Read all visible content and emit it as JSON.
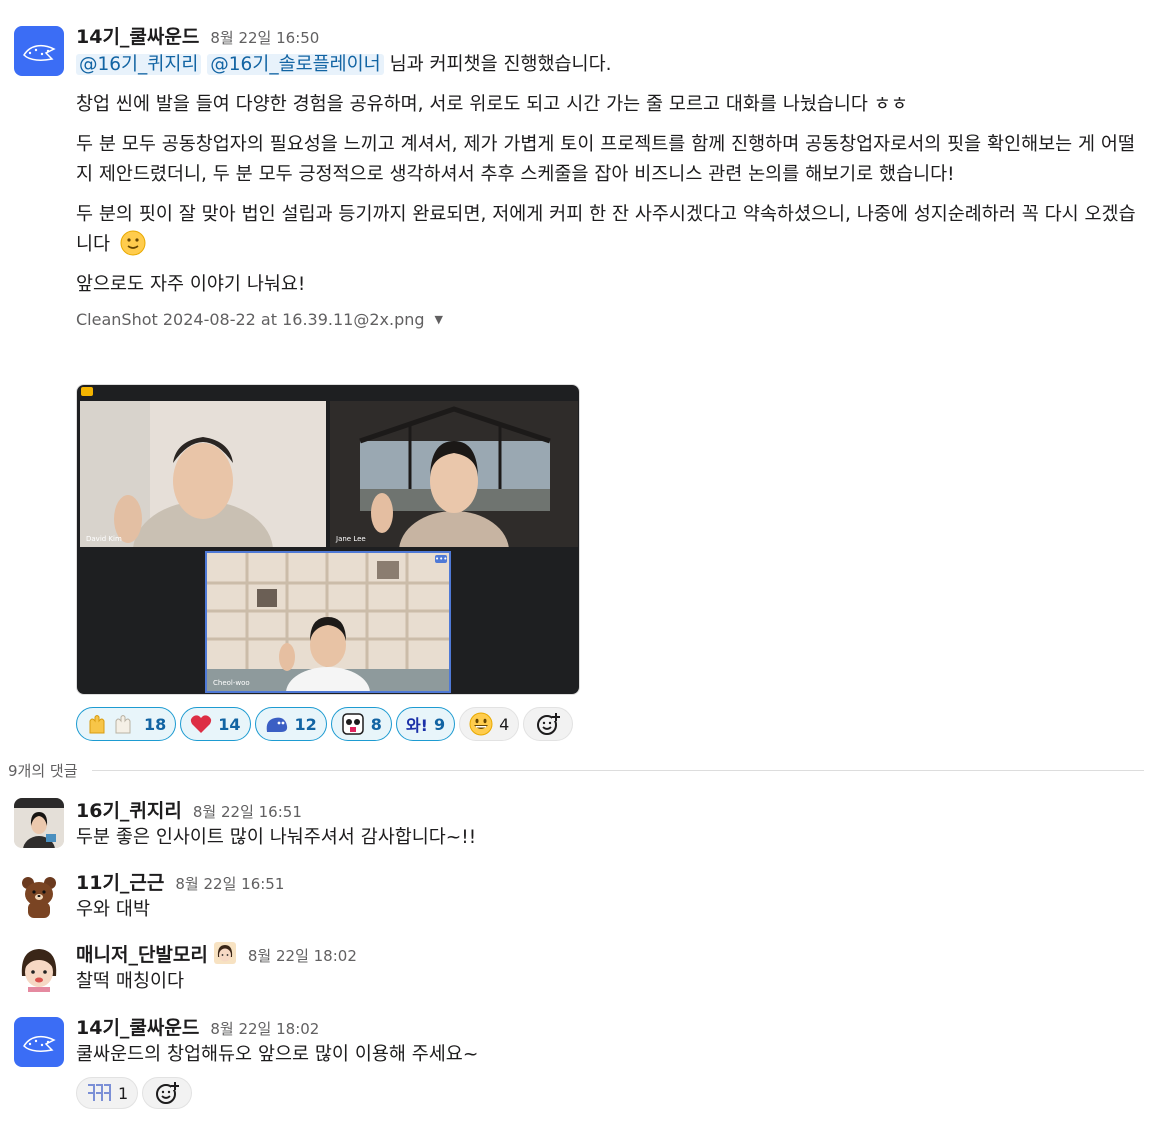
{
  "main_post": {
    "author": "14기_쿨싸운드",
    "time": "8월 22일 16:50",
    "mentions": [
      "@16기_퀴지리",
      "@16기_솔로플레이너"
    ],
    "first_line_suffix": "님과 커피챗을 진행했습니다.",
    "paragraphs": [
      "창업 씬에 발을 들여 다양한 경험을 공유하며, 서로 위로도 되고 시간 가는 줄 모르고 대화를 나눴습니다 ㅎㅎ",
      "두 분 모두 공동창업자의 필요성을 느끼고 계셔서, 제가 가볍게 토이 프로젝트를 함께 진행하며 공동창업자로서의 핏을 확인해보는 게 어떨지 제안드렸더니, 두 분 모두 긍정적으로 생각하셔서 추후 스케줄을 잡아 비즈니스 관련 논의를 해보기로 했습니다!",
      "두 분의 핏이 잘 맞아 법인 설립과 등기까지 완료되면, 저에게 커피 한 잔 사주시겠다고 약속하셨으니, 나중에 성지순례하러 꼭 다시 오겠습니다",
      "앞으로도 자주 이야기 나눠요!"
    ],
    "attachment_name": "CleanShot 2024-08-22 at 16.39.11@2x.png",
    "screenshot": {
      "tile1_label": "David Kim",
      "tile2_label": "Jane Lee",
      "tile3_label": "Cheol-woo"
    },
    "reactions": [
      {
        "emoji": "raising-hands-icon",
        "count": "18"
      },
      {
        "emoji": "heart-icon",
        "count": "14"
      },
      {
        "emoji": "blob-icon",
        "count": "12"
      },
      {
        "emoji": "face-icon",
        "count": "8"
      },
      {
        "emoji": "wow-text-icon",
        "label": "와!",
        "count": "9"
      },
      {
        "emoji": "grin-icon",
        "count": "4"
      }
    ]
  },
  "thread": {
    "reply_count_label": "9개의 댓글",
    "replies": [
      {
        "author": "16기_퀴지리",
        "time": "8월 22일 16:51",
        "text": "두분 좋은 인사이트 많이 나눠주셔서 감사합니다~!!"
      },
      {
        "author": "11기_근근",
        "time": "8월 22일 16:51",
        "text": "우와 대박"
      },
      {
        "author": "매니저_단발모리",
        "time": "8월 22일 18:02",
        "text": "찰떡 매칭이다"
      },
      {
        "author": "14기_쿨싸운드",
        "time": "8월 22일 18:02",
        "text": "쿨싸운드의 창업해듀오 앞으로 많이 이용해 주세요~",
        "reaction_count": "1"
      }
    ]
  },
  "colors": {
    "brand_blue": "#3b6df5",
    "mention_bg": "#e8f2fb",
    "mention_text": "#1264a3",
    "reaction_active_border": "#1d9bd1"
  }
}
